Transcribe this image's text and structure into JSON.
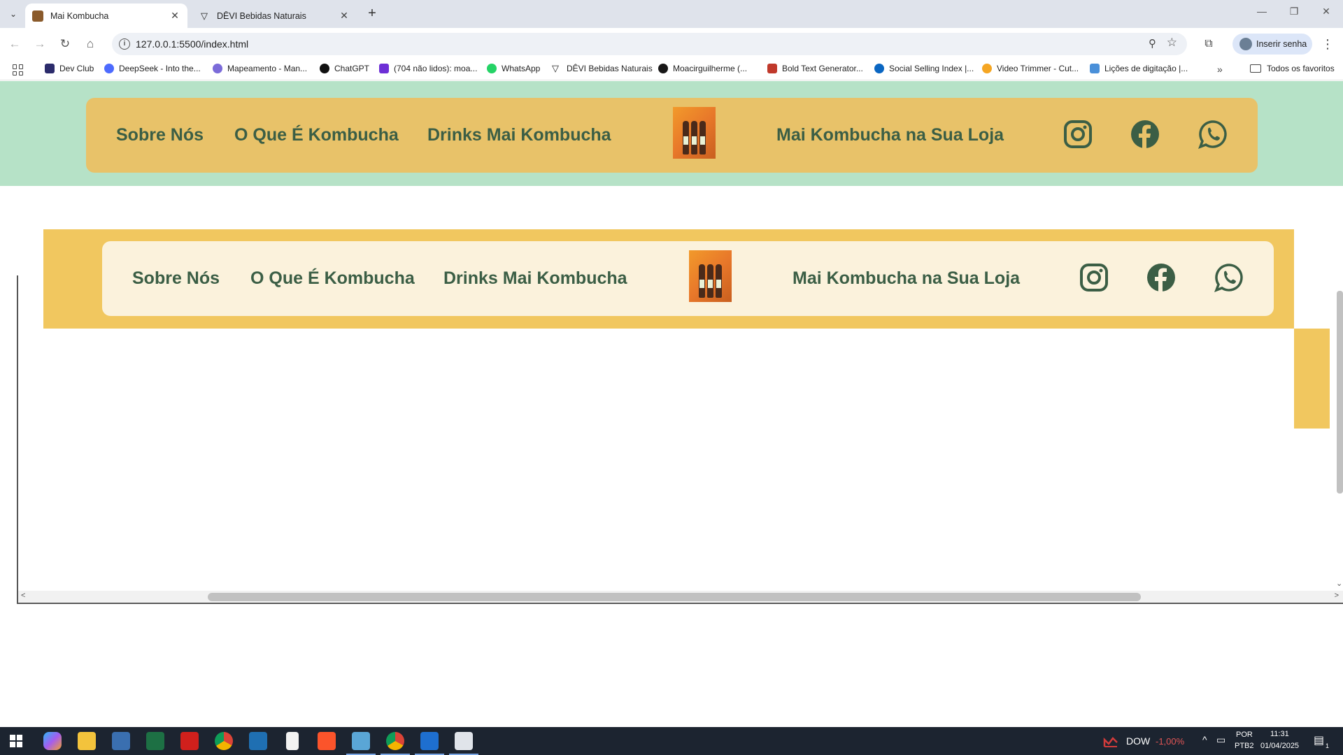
{
  "browser": {
    "tabs": [
      {
        "title": "Mai Kombucha",
        "active": true
      },
      {
        "title": "DÊVI Bebidas Naturais",
        "active": false
      }
    ],
    "url": "127.0.0.1:5500/index.html",
    "profile_label": "Inserir senha",
    "bookmarks": [
      {
        "label": "Dev Club",
        "color": "#2b2b6b"
      },
      {
        "label": "DeepSeek - Into the...",
        "color": "#4d6bfe"
      },
      {
        "label": "Mapeamento - Man...",
        "color": "#7b6bd9"
      },
      {
        "label": "ChatGPT",
        "color": "#111111"
      },
      {
        "label": "(704 não lidos): moa...",
        "color": "#6d2fd6"
      },
      {
        "label": "WhatsApp",
        "color": "#25d366"
      },
      {
        "label": "DÊVI Bebidas Naturais",
        "color": "#111111"
      },
      {
        "label": "Moacirguilherme (...",
        "color": "#181717"
      },
      {
        "label": "Bold Text Generator...",
        "color": "#c0392b"
      },
      {
        "label": "Social Selling Index |...",
        "color": "#0a66c2"
      },
      {
        "label": "Video Trimmer - Cut...",
        "color": "#f5a623"
      },
      {
        "label": "Lições de digitação |...",
        "color": "#4a90d9"
      }
    ],
    "all_bookmarks_label": "Todos os favoritos"
  },
  "site": {
    "colors": {
      "band": "#b6e2c7",
      "nav_card_1": "#e8c269",
      "nav_card_2": "#fbf2dc",
      "yellow_box": "#f1c75f",
      "link": "#3b5e45"
    },
    "nav_primary": {
      "about": "Sobre Nós",
      "what_is": "O Que É Kombucha",
      "drinks": "Drinks Mai Kombucha",
      "store": "Mai Kombucha na Sua Loja"
    },
    "nav_secondary": {
      "about": "Sobre Nós",
      "what_is": "O Que É Kombucha",
      "drinks": "Drinks Mai Kombucha",
      "store": "Mai Kombucha na Sua Loja"
    },
    "social_icons": [
      "instagram-icon",
      "facebook-icon",
      "whatsapp-icon"
    ]
  },
  "taskbar": {
    "ticker_name": "DOW",
    "ticker_change": "-1,00%",
    "lang_top": "POR",
    "lang_bottom": "PTB2",
    "time": "11:31",
    "date": "01/04/2025",
    "notification_count": "1"
  }
}
